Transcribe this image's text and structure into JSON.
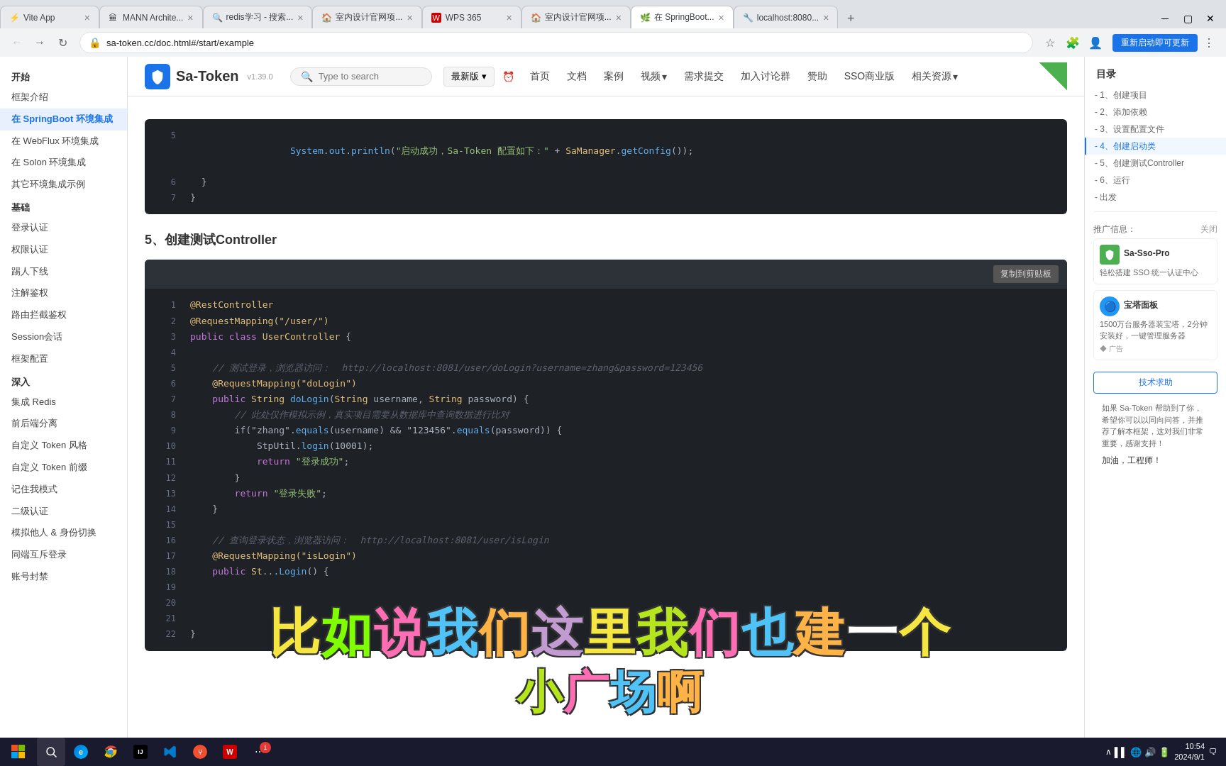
{
  "browser": {
    "tabs": [
      {
        "id": "t1",
        "title": "Vite App",
        "active": false,
        "favicon": "⚡"
      },
      {
        "id": "t2",
        "title": "MANN Archite...",
        "active": false,
        "favicon": "🏛"
      },
      {
        "id": "t3",
        "title": "redis学习 - 搜索...",
        "active": false,
        "favicon": "🔍"
      },
      {
        "id": "t4",
        "title": "室内设计官网项...",
        "active": false,
        "favicon": "🏠"
      },
      {
        "id": "t5",
        "title": "WPS 365",
        "active": false,
        "favicon": "W"
      },
      {
        "id": "t6",
        "title": "室内设计官网项...",
        "active": false,
        "favicon": "🏠"
      },
      {
        "id": "t7",
        "title": "在 SpringBoot...",
        "active": true,
        "favicon": "🌿"
      },
      {
        "id": "t8",
        "title": "localhost:8080...",
        "active": false,
        "favicon": "🔧"
      }
    ],
    "address": "sa-token.cc/doc.html#/start/example",
    "update_btn": "重新启动即可更新"
  },
  "header": {
    "logo_text": "Sa-Token",
    "logo_version": "v1.39.0",
    "search_placeholder": "Type to search",
    "nav_items": [
      "最新版 ▾",
      "⏰",
      "首页",
      "文档",
      "案例",
      "视频 ▾",
      "需求提交",
      "加入讨论群",
      "赞助",
      "SSO商业版",
      "相关资源 ▾"
    ]
  },
  "sidebar": {
    "sections": [
      {
        "title": "开始",
        "items": [
          {
            "label": "框架介绍",
            "active": false
          },
          {
            "label": "在 SpringBoot 环境集成",
            "active": true
          },
          {
            "label": "在 WebFlux 环境集成",
            "active": false
          },
          {
            "label": "在 Solon 环境集成",
            "active": false
          },
          {
            "label": "其它环境集成示例",
            "active": false
          }
        ]
      },
      {
        "title": "基础",
        "items": [
          {
            "label": "登录认证",
            "active": false
          },
          {
            "label": "权限认证",
            "active": false
          },
          {
            "label": "踢人下线",
            "active": false
          },
          {
            "label": "注解鉴权",
            "active": false
          },
          {
            "label": "路由拦截鉴权",
            "active": false
          },
          {
            "label": "Session会话",
            "active": false
          },
          {
            "label": "框架配置",
            "active": false
          }
        ]
      },
      {
        "title": "深入",
        "items": [
          {
            "label": "集成 Redis",
            "active": false
          },
          {
            "label": "前后端分离",
            "active": false
          },
          {
            "label": "自定义 Token 风格",
            "active": false
          },
          {
            "label": "自定义 Token 前缀",
            "active": false
          },
          {
            "label": "记住我模式",
            "active": false
          },
          {
            "label": "二级认证",
            "active": false
          },
          {
            "label": "模拟他人 & 身份切换",
            "active": false
          },
          {
            "label": "同端互斥登录",
            "active": false
          },
          {
            "label": "账号封禁",
            "active": false
          }
        ]
      }
    ]
  },
  "content": {
    "prev_code_lines": [
      {
        "num": 5,
        "content": "    System.out.println(\"启动成功，Sa-Token 配置如下：\" + SaManager.getConfig());"
      },
      {
        "num": 6,
        "content": "  }"
      },
      {
        "num": 7,
        "content": "}"
      }
    ],
    "section_title": "5、创建测试Controller",
    "copy_btn": "复制到剪贴板",
    "code_lines": [
      {
        "num": 1,
        "parts": [
          {
            "t": "@RestController",
            "c": "kw-yellow"
          }
        ]
      },
      {
        "num": 2,
        "parts": [
          {
            "t": "@RequestMapping(\"/user/\")",
            "c": "kw-yellow"
          }
        ]
      },
      {
        "num": 3,
        "parts": [
          {
            "t": "public ",
            "c": "kw-purple"
          },
          {
            "t": "class ",
            "c": "kw-purple"
          },
          {
            "t": "UserController ",
            "c": "kw-yellow"
          },
          {
            "t": "{",
            "c": "kw-white"
          }
        ]
      },
      {
        "num": 4,
        "parts": []
      },
      {
        "num": 5,
        "parts": [
          {
            "t": "    // 测试登录，浏览器访问：  http://localhost:8081/user/doLogin?username=zhang&password=123456",
            "c": "kw-gray"
          }
        ]
      },
      {
        "num": 6,
        "parts": [
          {
            "t": "    @RequestMapping(\"doLogin\")",
            "c": "kw-yellow"
          }
        ]
      },
      {
        "num": 7,
        "parts": [
          {
            "t": "    public ",
            "c": "kw-purple"
          },
          {
            "t": "String ",
            "c": "kw-yellow"
          },
          {
            "t": "doLogin(",
            "c": "kw-blue"
          },
          {
            "t": "String ",
            "c": "kw-yellow"
          },
          {
            "t": "username, ",
            "c": "kw-white"
          },
          {
            "t": "String ",
            "c": "kw-yellow"
          },
          {
            "t": "password) {",
            "c": "kw-white"
          }
        ]
      },
      {
        "num": 8,
        "parts": [
          {
            "t": "        // 此处仅作模拟示例，真实项目需要从数据库中查询数据进行比对",
            "c": "kw-gray"
          }
        ]
      },
      {
        "num": 9,
        "parts": [
          {
            "t": "        if(\"zhang\".",
            "c": "kw-white"
          },
          {
            "t": "equals",
            "c": "kw-blue"
          },
          {
            "t": "(username) && \"123456\".",
            "c": "kw-white"
          },
          {
            "t": "equals",
            "c": "kw-blue"
          },
          {
            "t": "(password)) {",
            "c": "kw-white"
          }
        ]
      },
      {
        "num": 10,
        "parts": [
          {
            "t": "            StpUtil.",
            "c": "kw-white"
          },
          {
            "t": "login",
            "c": "kw-blue"
          },
          {
            "t": "(10001);",
            "c": "kw-white"
          }
        ]
      },
      {
        "num": 11,
        "parts": [
          {
            "t": "            return ",
            "c": "kw-purple"
          },
          {
            "t": "\"登录成功\"",
            "c": "kw-green"
          },
          {
            "t": ";",
            "c": "kw-white"
          }
        ]
      },
      {
        "num": 12,
        "parts": [
          {
            "t": "        }",
            "c": "kw-white"
          }
        ]
      },
      {
        "num": 13,
        "parts": [
          {
            "t": "        return ",
            "c": "kw-purple"
          },
          {
            "t": "\"登录失败\"",
            "c": "kw-green"
          },
          {
            "t": ";",
            "c": "kw-white"
          }
        ]
      },
      {
        "num": 14,
        "parts": [
          {
            "t": "    }",
            "c": "kw-white"
          }
        ]
      },
      {
        "num": 15,
        "parts": []
      },
      {
        "num": 16,
        "parts": [
          {
            "t": "    // 查询登录状态，浏览器访问：  http://localhost:8081/user/isLogin",
            "c": "kw-gray"
          }
        ]
      },
      {
        "num": 17,
        "parts": [
          {
            "t": "    @RequestMapping(\"isLogin\")",
            "c": "kw-yellow"
          }
        ]
      },
      {
        "num": 18,
        "parts": [
          {
            "t": "    public ",
            "c": "kw-purple"
          },
          {
            "t": "St",
            "c": "kw-yellow"
          },
          {
            "t": "...",
            "c": "kw-white"
          },
          {
            "t": "Login() {",
            "c": "kw-blue"
          }
        ]
      },
      {
        "num": 19,
        "parts": []
      },
      {
        "num": 20,
        "parts": []
      },
      {
        "num": 21,
        "parts": []
      },
      {
        "num": 22,
        "parts": [
          {
            "t": "}",
            "c": "kw-white"
          }
        ]
      }
    ]
  },
  "toc": {
    "title": "目录",
    "items": [
      {
        "label": "- 1、创建项目",
        "active": false
      },
      {
        "label": "- 2、添加依赖",
        "active": false
      },
      {
        "label": "- 3、设置配置文件",
        "active": false
      },
      {
        "label": "- 4、创建启动类",
        "active": true
      },
      {
        "label": "- 5、创建测试Controller",
        "active": false
      },
      {
        "label": "- 6、运行",
        "active": false
      },
      {
        "label": "- 出发",
        "active": false
      }
    ]
  },
  "promo": {
    "label": "推广信息：",
    "close": "关闭",
    "card1": {
      "title": "Sa-Sso-Pro",
      "desc": "轻松搭建 SSO 统一认证中心"
    },
    "card2": {
      "title": "宝塔面板",
      "desc": "1500万台服务器装宝塔，2分钟安装好，一键管理服务器"
    },
    "ad_label": "◆ 广告",
    "tech_btn": "技术求助",
    "helper_text": "如果 Sa-Token 帮助到了你，希望你可以以同向问答，并推荐了解本框架，这对我们非常重要，感谢支持！",
    "encourage": "加油，工程师！"
  },
  "overlay": {
    "line1": "比如说我们这里我们也建一个",
    "line2": "小广场啊"
  },
  "taskbar": {
    "time": "10:54",
    "date": "2024/9/1"
  }
}
